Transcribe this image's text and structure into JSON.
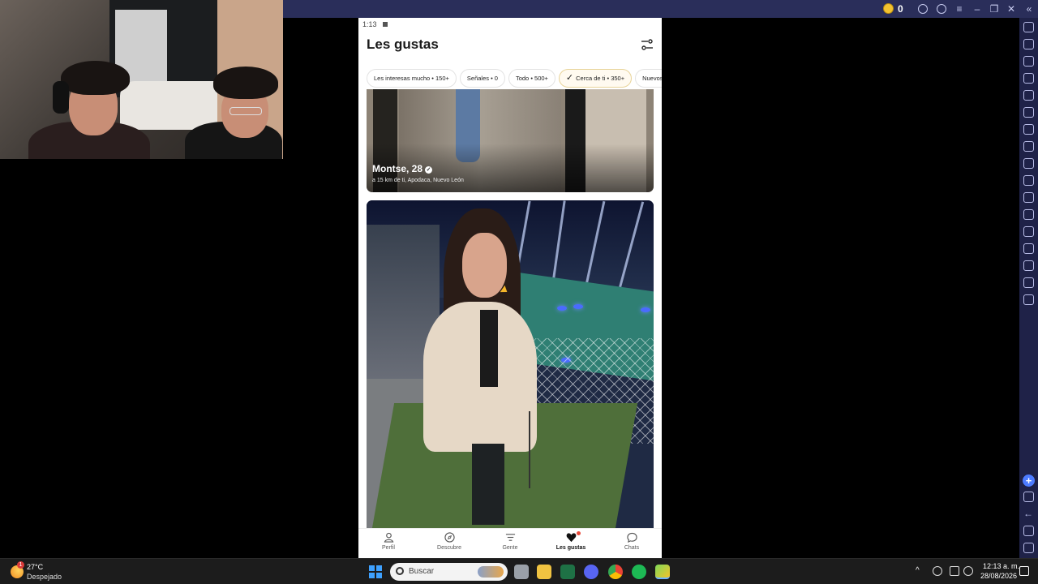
{
  "emulator": {
    "coin_count": "0"
  },
  "phone": {
    "status_time": "1:13",
    "title": "Les gustas",
    "chips": [
      {
        "label": "Les interesas mucho • 150+",
        "active": false
      },
      {
        "label": "Señales • 0",
        "active": false
      },
      {
        "label": "Todo • 500+",
        "active": false
      },
      {
        "label": "Cerca de ti • 350+",
        "active": true
      },
      {
        "label": "Nuevos •",
        "active": false
      }
    ],
    "cards": [
      {
        "name": "Montse, 28",
        "location": "a 15 km de ti, Apodaca, Nuevo León",
        "verified": true
      },
      {
        "name": "",
        "location": "",
        "verified": false
      }
    ],
    "bottom_nav": [
      {
        "label": "Perfil",
        "icon": "profile-icon",
        "active": false
      },
      {
        "label": "Descubre",
        "icon": "compass-icon",
        "active": false
      },
      {
        "label": "Gente",
        "icon": "people-icon",
        "active": false
      },
      {
        "label": "Les gustas",
        "icon": "heart-icon",
        "active": true
      },
      {
        "label": "Chats",
        "icon": "chat-icon",
        "active": false
      }
    ]
  },
  "taskbar": {
    "weather_temp": "27°C",
    "weather_desc": "Despejado",
    "weather_badge": "1",
    "search_placeholder": "Buscar",
    "clock_time": "12:13 a. m.",
    "clock_date": "28/08/2026"
  },
  "colors": {
    "emulator_bar": "#2a2e5a",
    "accent_chip_border": "#e8d49a",
    "notification_dot": "#e84a3b"
  }
}
